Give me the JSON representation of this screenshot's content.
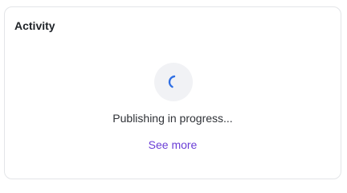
{
  "card": {
    "title": "Activity"
  },
  "activity": {
    "status_text": "Publishing in progress...",
    "link_label": "See more",
    "spinner_icon": "loading-spinner-icon"
  },
  "colors": {
    "spinner_accent": "#2f6fe4",
    "link": "#6b3fd6",
    "spinner_background": "#f1f2f5"
  }
}
